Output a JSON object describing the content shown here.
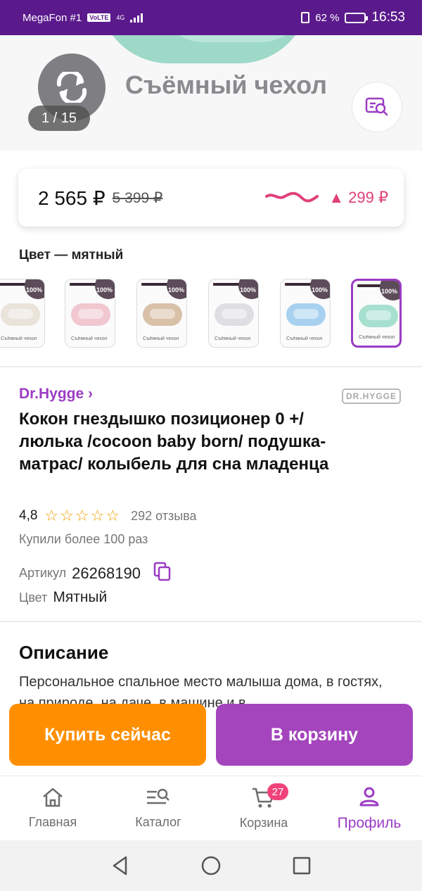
{
  "status_bar": {
    "carrier": "MegaFon #1",
    "volte": "VoLTE",
    "network": "4G",
    "battery_percent": "62 %",
    "battery_level": 0.62,
    "time": "16:53"
  },
  "gallery": {
    "caption": "Съёмный чехол",
    "counter": "1 / 15"
  },
  "price": {
    "current": "2 565 ₽",
    "old": "5 399 ₽",
    "delta": "299 ₽"
  },
  "color_selector": {
    "label": "Цвет — мятный",
    "swatches": [
      {
        "color": "#e9e3da",
        "badge": "100%",
        "text": "Съёмный чехол"
      },
      {
        "color": "#f1c7d0",
        "badge": "100%",
        "text": "Съёмный чехол"
      },
      {
        "color": "#d9c1a9",
        "badge": "100%",
        "text": "Съёмный чехол"
      },
      {
        "color": "#dedee3",
        "badge": "100%",
        "text": "Съёмный чехол"
      },
      {
        "color": "#a8d1f0",
        "badge": "100%",
        "text": "Съёмный чехол"
      },
      {
        "color": "#a7e0cf",
        "badge": "100%",
        "text": "Съёмный чехол"
      }
    ]
  },
  "product": {
    "brand": "Dr.Hygge ›",
    "brand_logo": "DR.HYGGE",
    "title": "Кокон гнездышко позиционер 0 +/люлька /cocoon baby born/ подушка-матрас/ колыбель для сна младенца",
    "rating": "4,8",
    "reviews": "292 отзыва",
    "bought": "Купили более 100 раз",
    "sku_label": "Артикул",
    "sku_value": "26268190",
    "color_label": "Цвет",
    "color_value": "Мятный"
  },
  "description": {
    "title": "Описание",
    "text": "Персональное спальное место малыша дома, в гостях, на природе, на даче, в машине и в"
  },
  "actions": {
    "buy_now": "Купить сейчас",
    "add_to_cart": "В корзину"
  },
  "bottom_nav": {
    "items": [
      {
        "label": "Главная",
        "icon": "home-icon"
      },
      {
        "label": "Каталог",
        "icon": "catalog-icon"
      },
      {
        "label": "Корзина",
        "icon": "cart-icon",
        "badge": "27"
      },
      {
        "label": "Профиль",
        "icon": "profile-icon"
      }
    ]
  },
  "colors": {
    "brand_purple": "#9b3cc4",
    "status_bar": "#5b1a8c",
    "buy_orange": "#ff8f00",
    "cart_purple": "#a445bd",
    "price_delta_pink": "#e0407a"
  }
}
